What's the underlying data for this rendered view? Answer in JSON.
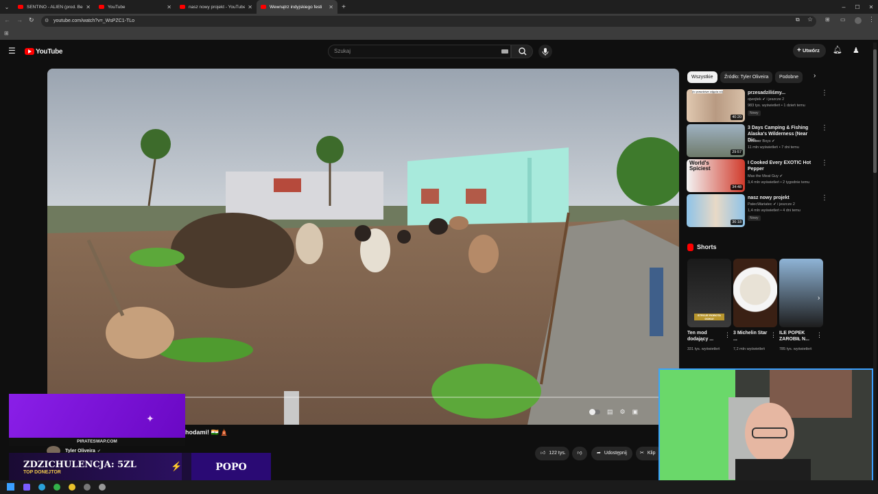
{
  "browser": {
    "tabs": [
      {
        "title": "SENTINO - ALIEN (prod. Beatho",
        "active": false
      },
      {
        "title": "YouTube",
        "active": false
      },
      {
        "title": "nasz nowy projekt - YouTube",
        "active": false
      },
      {
        "title": "Wewnątrz indyjskiego festi",
        "active": true
      }
    ],
    "url": "youtube.com/watch?v=_WsPZC1-TLo"
  },
  "youtube": {
    "logo_text": "YouTube",
    "search_placeholder": "Szukaj",
    "create_label": "Utwórz"
  },
  "player": {
    "title_partial": "hodami! 🇮🇳 🛕",
    "channel": "Tyler Oliveira",
    "likes": "122 tys.",
    "share_label": "Udostępnij",
    "clip_label": "Klip"
  },
  "chips": [
    "Wszystkie",
    "Źródło: Tyler Oliveira",
    "Podobne"
  ],
  "recommendations": [
    {
      "title": "przesadziliśmy...",
      "channel": "ojwojtek",
      "channel_suffix": "i jeszcze 2",
      "meta": "983 tys. wyświetleń • 1 dzień temu",
      "badge": "Nowy",
      "duration": "40:20",
      "thumb_caption": "(to prawdziwe zdjęcia xd)"
    },
    {
      "title": "3 Days Camping & Fishing Alaska's Wilderness (Near Dic...",
      "channel": "Outdoor Boys",
      "channel_suffix": "",
      "meta": "11 mln wyświetleń • 7 dni temu",
      "badge": "",
      "duration": "29:57",
      "thumb_caption": ""
    },
    {
      "title": "I Cooked Every EXOTIC Hot Pepper",
      "channel": "Max the Meat Guy",
      "channel_suffix": "",
      "meta": "3,4 mln wyświetleń • 2 tygodnie temu",
      "badge": "",
      "duration": "34:48",
      "thumb_caption": "World's Spiciest"
    },
    {
      "title": "nasz nowy projekt",
      "channel": "PatecWariatec",
      "channel_suffix": "i jeszcze 2",
      "meta": "1,4 mln wyświetleń • 4 dni temu",
      "badge": "Nowy",
      "duration": "36:18",
      "thumb_caption": ""
    }
  ],
  "shorts": {
    "heading": "Shorts",
    "items": [
      {
        "title": "Ten mod dodający ...",
        "views": "331 tys. wyświetleń",
        "caption": "STROJE ROBOTA GOKU!"
      },
      {
        "title": "3 Michelin Star ...",
        "views": "7,2 mln wyświetleń",
        "caption": ""
      },
      {
        "title": "ILE POPEK ZAROBIŁ N...",
        "views": "785 tys. wyświetleń",
        "caption": ""
      }
    ]
  },
  "overlays": {
    "promo_site": "PIRATESWAP.COM",
    "donate_line": "ZDZICHULENCJA: 5ZL",
    "donate_sub": "TOP DONEJTOR",
    "donate_name": "POPO"
  },
  "colors": {
    "brand_red": "#ff0000",
    "promo_purple": "#7b10d8",
    "webcam_border": "#3aa0ff"
  }
}
